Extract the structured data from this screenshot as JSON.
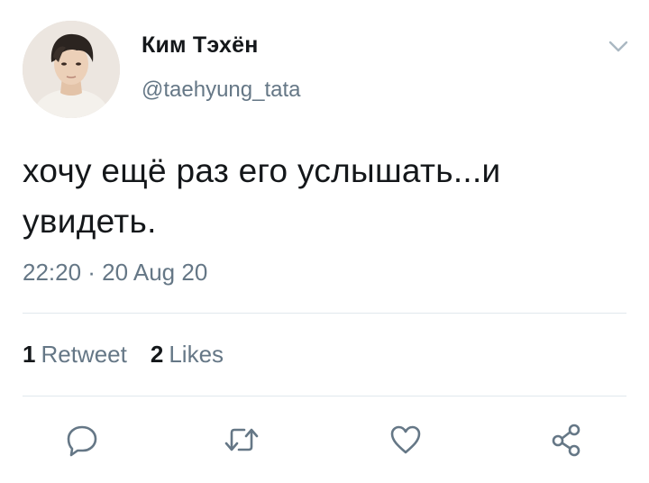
{
  "tweet": {
    "author": {
      "display_name": "Ким Тэхён",
      "handle": "@taehyung_tata"
    },
    "text_line1": "хочу ещё раз его услышать...и",
    "text_line2": "увидеть.",
    "timestamp": "22:20 · 20 Aug 20",
    "stats": {
      "retweets_count": "1",
      "retweets_label": "Retweet",
      "likes_count": "2",
      "likes_label": "Likes"
    }
  },
  "icons": {
    "caret": "chevron-down-icon",
    "reply": "reply-icon",
    "retweet": "retweet-icon",
    "like": "heart-icon",
    "share": "share-icon"
  },
  "colors": {
    "text_primary": "#14171a",
    "text_secondary": "#657786",
    "icon": "#657786",
    "divider": "#e1e8ed"
  }
}
